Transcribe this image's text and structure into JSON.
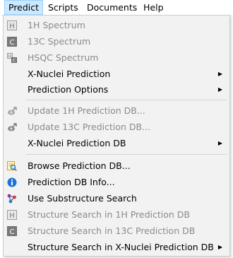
{
  "menubar": {
    "items": [
      {
        "label": "Predict"
      },
      {
        "label": "Scripts"
      },
      {
        "label": "Documents"
      },
      {
        "label": "Help"
      }
    ]
  },
  "menu": {
    "items": [
      {
        "label": "1H Spectrum",
        "icon": "h-nucleus-icon",
        "enabled": false
      },
      {
        "label": "13C Spectrum",
        "icon": "c-nucleus-icon",
        "enabled": false
      },
      {
        "label": "HSQC Spectrum",
        "icon": "hsqc-icon",
        "enabled": false
      },
      {
        "label": "X-Nuclei Prediction",
        "submenu": true
      },
      {
        "label": "Prediction Options",
        "submenu": true
      },
      {
        "label": "Update 1H Prediction DB...",
        "icon": "update-db-icon",
        "enabled": false
      },
      {
        "label": "Update 13C Prediction DB...",
        "icon": "update-db-icon",
        "enabled": false
      },
      {
        "label": "X-Nuclei Prediction DB",
        "submenu": true
      },
      {
        "label": "Browse Prediction DB...",
        "icon": "browse-db-icon",
        "enabled": true
      },
      {
        "label": "Prediction DB Info...",
        "icon": "info-icon",
        "enabled": true
      },
      {
        "label": "Use Substructure Search",
        "icon": "substructure-icon",
        "enabled": true
      },
      {
        "label": "Structure Search in 1H Prediction DB",
        "icon": "h-nucleus-icon",
        "enabled": false
      },
      {
        "label": "Structure Search in 13C Prediction DB",
        "icon": "c-nucleus-icon",
        "enabled": false
      },
      {
        "label": "Structure Search in X-Nuclei Prediction DB",
        "submenu": true
      }
    ]
  },
  "colors": {
    "active_menubar_bg": "#cce8ff",
    "disabled_text": "#8a8a8a",
    "menu_bg": "#f2f2f2"
  }
}
